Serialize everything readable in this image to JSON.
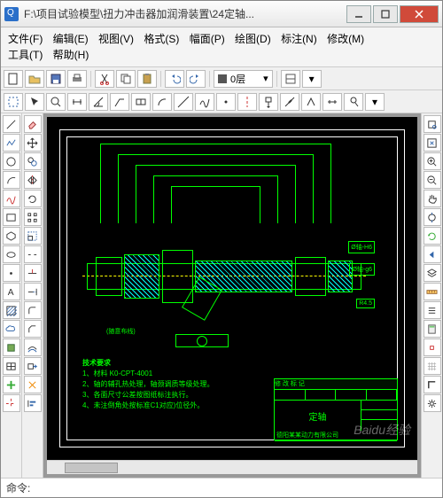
{
  "window": {
    "title": "F:\\项目试验模型\\扭力冲击器加润滑装置\\24定轴..."
  },
  "menu": {
    "file": "文件(F)",
    "edit": "编辑(E)",
    "view": "视图(V)",
    "format": "格式(S)",
    "page": "幅面(P)",
    "draw": "绘图(D)",
    "annotate": "标注(N)",
    "modify": "修改(M)",
    "tools": "工具(T)",
    "help": "帮助(H)"
  },
  "layer": {
    "current": "0层"
  },
  "drawing": {
    "part_name": "定轴",
    "tech_req_header": "技术要求",
    "tech_req_1": "1、材料 K0-CPT-4001",
    "tech_req_2": "2、轴的辅孔热处理，轴颈调质等级处理。",
    "tech_req_3": "3、各面尺寸公差按图纸标注执行。",
    "tech_req_4": "4、未注倒角处按标准C1对应)位径外。",
    "rev_header": "修 改 标 记",
    "company": "德阳某某动力有限公司",
    "dim1": "Ø轴-H6",
    "dim2": "Ø轴-g6",
    "dim3": "R4.5",
    "ref": "(随意布线)"
  },
  "command": {
    "prompt": "命令:",
    "value": ""
  },
  "watermark": "Baidu经验"
}
